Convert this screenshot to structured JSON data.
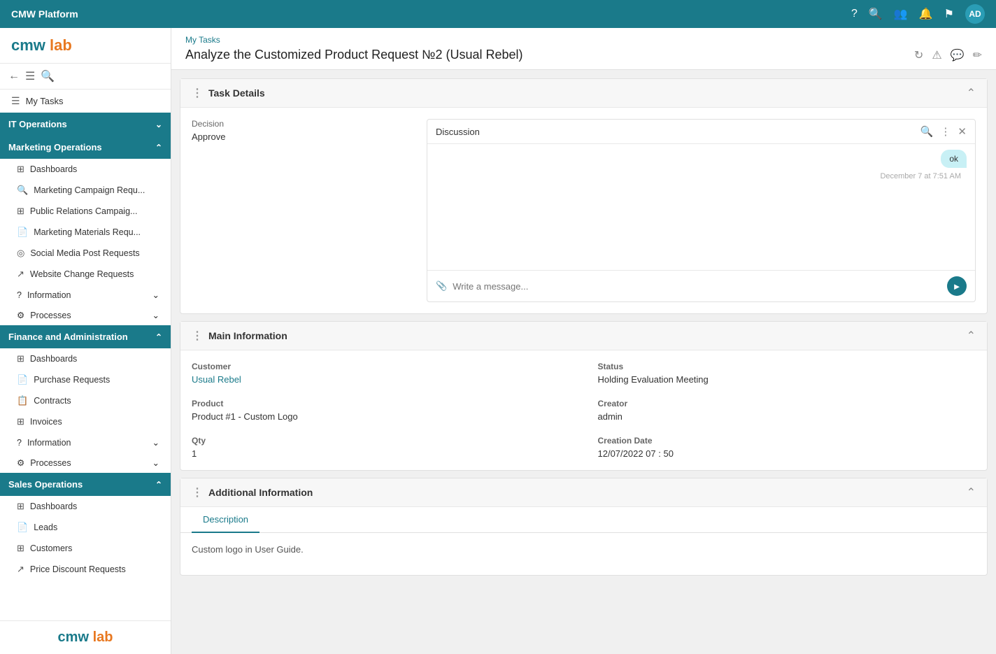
{
  "app": {
    "title": "CMW Platform",
    "avatar": "AD"
  },
  "logo": {
    "cmw": "cmw",
    "lab": "lab"
  },
  "breadcrumb": "My Tasks",
  "page_title": "Analyze the Customized Product Request №2 (Usual Rebel)",
  "sidebar": {
    "my_tasks_label": "My Tasks",
    "sections": [
      {
        "id": "it-operations",
        "label": "IT Operations",
        "active": false,
        "expanded": false
      },
      {
        "id": "marketing-operations",
        "label": "Marketing Operations",
        "active": true,
        "expanded": true,
        "items": [
          {
            "label": "Dashboards",
            "icon": "grid"
          },
          {
            "label": "Marketing Campaign Requ...",
            "icon": "search"
          },
          {
            "label": "Public Relations Campaig...",
            "icon": "chart"
          },
          {
            "label": "Marketing Materials Requ...",
            "icon": "doc"
          },
          {
            "label": "Social Media Post Requests",
            "icon": "globe"
          },
          {
            "label": "Website Change Requests",
            "icon": "link"
          }
        ],
        "collapsible": [
          {
            "label": "Information",
            "expanded": false
          },
          {
            "label": "Processes",
            "expanded": false
          }
        ]
      },
      {
        "id": "finance-admin",
        "label": "Finance and Administration",
        "active": true,
        "expanded": true,
        "items": [
          {
            "label": "Dashboards",
            "icon": "grid"
          },
          {
            "label": "Purchase Requests",
            "icon": "doc"
          },
          {
            "label": "Contracts",
            "icon": "doc2"
          },
          {
            "label": "Invoices",
            "icon": "invoice"
          }
        ],
        "collapsible": [
          {
            "label": "Information",
            "expanded": false
          },
          {
            "label": "Processes",
            "expanded": false
          }
        ]
      },
      {
        "id": "sales-operations",
        "label": "Sales Operations",
        "active": true,
        "expanded": true,
        "items": [
          {
            "label": "Dashboards",
            "icon": "grid"
          },
          {
            "label": "Leads",
            "icon": "lead"
          },
          {
            "label": "Customers",
            "icon": "customer"
          },
          {
            "label": "Price Discount Requests",
            "icon": "discount"
          }
        ]
      }
    ]
  },
  "task_details": {
    "panel_title": "Task Details",
    "decision_label": "Decision",
    "decision_value": "Approve",
    "discussion_title": "Discussion",
    "message_text": "ok",
    "message_time": "December 7 at 7:51 AM",
    "input_placeholder": "Write a message..."
  },
  "main_information": {
    "panel_title": "Main Information",
    "customer_label": "Customer",
    "customer_value": "Usual Rebel",
    "status_label": "Status",
    "status_value": "Holding Evaluation Meeting",
    "product_label": "Product",
    "product_value": "Product #1 - Custom Logo",
    "creator_label": "Creator",
    "creator_value": "admin",
    "qty_label": "Qty",
    "qty_value": "1",
    "creation_date_label": "Creation Date",
    "creation_date_value": "12/07/2022   07 : 50"
  },
  "additional_information": {
    "panel_title": "Additional Information",
    "tabs": [
      {
        "label": "Description",
        "active": true
      }
    ],
    "description_text": "Custom logo in User Guide."
  }
}
